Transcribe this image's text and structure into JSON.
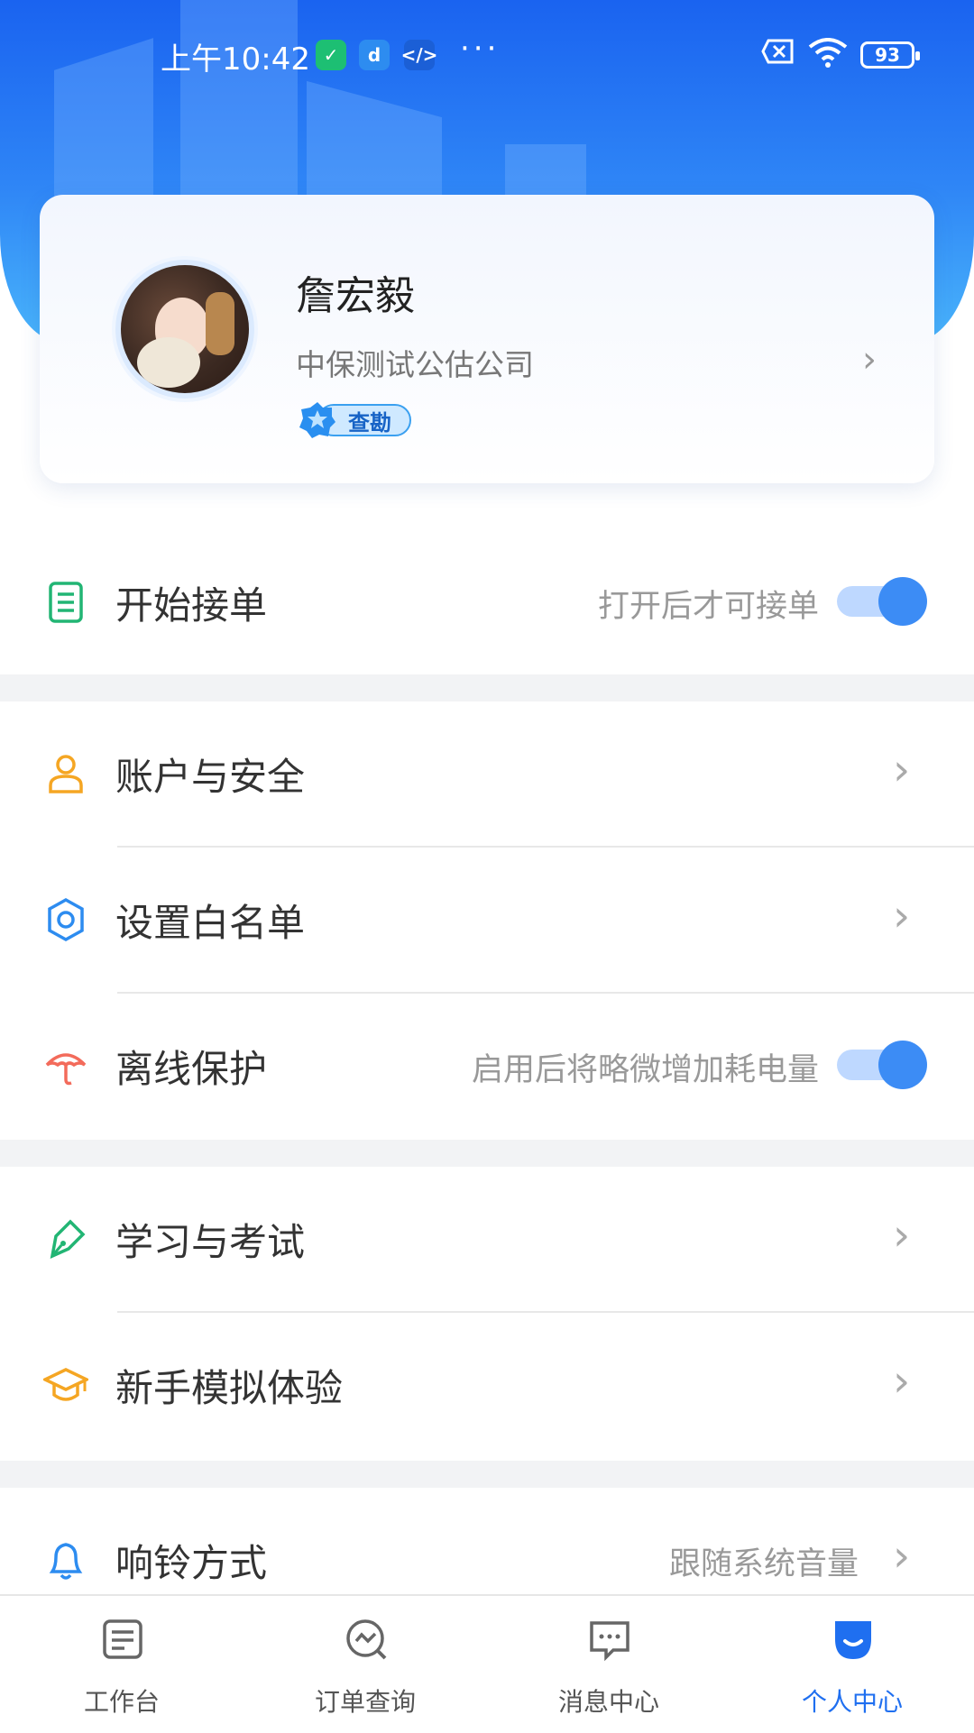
{
  "status_bar": {
    "time": "上午10:42",
    "battery": "93"
  },
  "profile": {
    "name": "詹宏毅",
    "company": "中保测试公估公司",
    "badge": "查勘"
  },
  "settings": {
    "accept_orders": {
      "label": "开始接单",
      "hint": "打开后才可接单",
      "toggle_on": true
    },
    "account_security": {
      "label": "账户与安全"
    },
    "whitelist": {
      "label": "设置白名单"
    },
    "offline_protection": {
      "label": "离线保护",
      "hint": "启用后将略微增加耗电量",
      "toggle_on": true
    },
    "study_exam": {
      "label": "学习与考试"
    },
    "beginner_sim": {
      "label": "新手模拟体验"
    },
    "ringtone": {
      "label": "响铃方式",
      "hint": "跟随系统音量"
    }
  },
  "tabbar": {
    "items": [
      {
        "label": "工作台",
        "icon": "workbench-icon"
      },
      {
        "label": "订单查询",
        "icon": "order-search-icon"
      },
      {
        "label": "消息中心",
        "icon": "message-icon"
      },
      {
        "label": "个人中心",
        "icon": "profile-icon",
        "active": true
      }
    ]
  },
  "colors": {
    "accent": "#1f6ff0",
    "toggle_knob": "#3c8cf5",
    "toggle_track": "#bed8ff"
  }
}
